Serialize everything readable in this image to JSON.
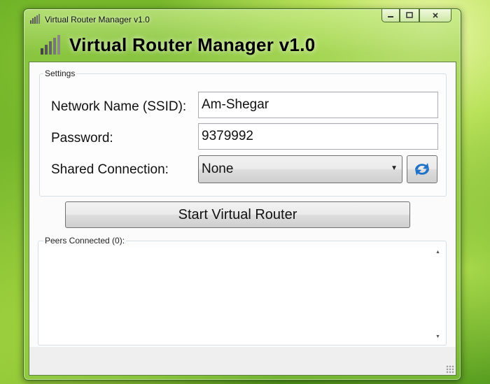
{
  "window": {
    "title": "Virtual Router Manager v1.0",
    "header": "Virtual Router Manager v1.0",
    "caption_buttons": {
      "minimize": "minimize-icon",
      "maximize": "maximize-icon",
      "close": "close-icon"
    }
  },
  "settings": {
    "group_label": "Settings",
    "network_name_label": "Network Name (SSID):",
    "network_name_value": "Am-Shegar",
    "password_label": "Password:",
    "password_value": "9379992",
    "shared_connection_label": "Shared Connection:",
    "shared_connection_value": "None",
    "refresh_icon": "refresh-arrows-icon"
  },
  "actions": {
    "start_label": "Start Virtual Router"
  },
  "peers": {
    "label": "Peers Connected (0):"
  },
  "colors": {
    "accent_blue": "#1e73c8",
    "window_glass": "#9ccf4f"
  }
}
